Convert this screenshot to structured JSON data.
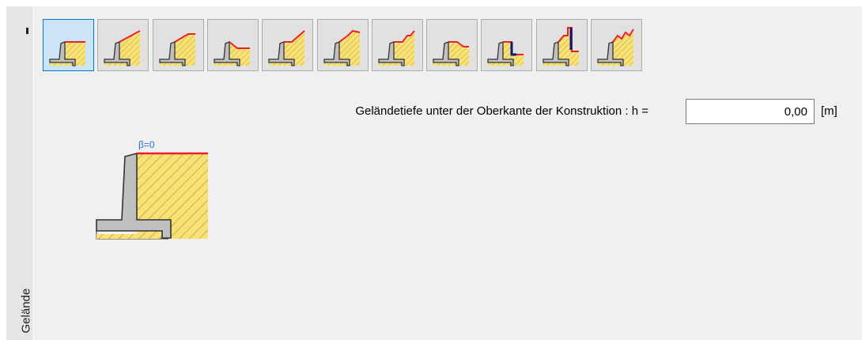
{
  "sidebar": {
    "tab_label": "Gelände"
  },
  "toolbar": {
    "buttons": [
      {
        "name": "terrain-horizontal-button",
        "icon": "terrain-horizontal-icon",
        "selected": true
      },
      {
        "name": "terrain-slope-button",
        "icon": "terrain-slope-icon",
        "selected": false
      },
      {
        "name": "terrain-slope-berm-button",
        "icon": "terrain-slope-berm-icon",
        "selected": false
      },
      {
        "name": "terrain-descending-button",
        "icon": "terrain-descending-icon",
        "selected": false
      },
      {
        "name": "terrain-berm-slope-button",
        "icon": "terrain-berm-slope-icon",
        "selected": false
      },
      {
        "name": "terrain-broken-button",
        "icon": "terrain-broken-icon",
        "selected": false
      },
      {
        "name": "terrain-stepped-button",
        "icon": "terrain-stepped-icon",
        "selected": false
      },
      {
        "name": "terrain-slope-down-button",
        "icon": "terrain-slope-down-icon",
        "selected": false
      },
      {
        "name": "terrain-low-wall-button",
        "icon": "terrain-low-wall-icon",
        "selected": false
      },
      {
        "name": "terrain-high-wall-button",
        "icon": "terrain-high-wall-icon",
        "selected": false
      },
      {
        "name": "terrain-general-button",
        "icon": "terrain-general-icon",
        "selected": false
      }
    ]
  },
  "depth": {
    "label": "Geländetiefe unter der Oberkante der Konstruktion : h =",
    "value": "0,00",
    "unit": "[m]"
  },
  "preview": {
    "beta_label": "β=0"
  },
  "colors": {
    "hatch_fill": "#f7e27a",
    "hatch_line": "#c9a21c",
    "terrain_line": "#e8222b",
    "wall_fill": "#c0c0c0",
    "wall_outline": "#333333",
    "accent_dark": "#0a1a7a",
    "beta_text": "#2f6fdb",
    "selected_bg": "#cce4f7",
    "selected_border": "#0078d7"
  }
}
